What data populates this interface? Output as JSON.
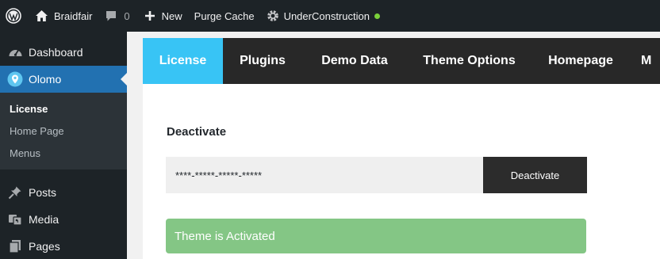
{
  "adminbar": {
    "wp_icon": "wordpress-logo-icon",
    "site_icon": "home-icon",
    "site_name": "Braidfair",
    "comments_icon": "comment-bubble-icon",
    "comments_count": "0",
    "new_icon": "plus-icon",
    "new_label": "New",
    "purge_label": "Purge Cache",
    "uc_icon": "gear-icon",
    "uc_label": "UnderConstruction",
    "uc_status_color": "#7ad03a"
  },
  "sidebar": {
    "dashboard": {
      "icon": "dashboard-icon",
      "label": "Dashboard"
    },
    "olomo": {
      "icon": "location-pin-icon",
      "label": "Olomo"
    },
    "submenu": [
      {
        "label": "License",
        "current": true
      },
      {
        "label": "Home Page",
        "current": false
      },
      {
        "label": "Menus",
        "current": false
      }
    ],
    "posts": {
      "icon": "pin-icon",
      "label": "Posts"
    },
    "media": {
      "icon": "media-icon",
      "label": "Media"
    },
    "pages": {
      "icon": "pages-icon",
      "label": "Pages"
    }
  },
  "tabs": [
    {
      "label": "License",
      "active": true
    },
    {
      "label": "Plugins",
      "active": false
    },
    {
      "label": "Demo Data",
      "active": false
    },
    {
      "label": "Theme Options",
      "active": false
    },
    {
      "label": "Homepage",
      "active": false
    },
    {
      "label": "M",
      "active": false
    }
  ],
  "license": {
    "title": "Deactivate",
    "key_value": "****-*****-*****-*****",
    "button_label": "Deactivate",
    "notice": "Theme is Activated"
  },
  "colors": {
    "admin_bg": "#1d2327",
    "menu_active": "#2271b1",
    "tab_active": "#38c4f5",
    "tabs_bg": "#282828",
    "notice_bg": "#84c685"
  }
}
